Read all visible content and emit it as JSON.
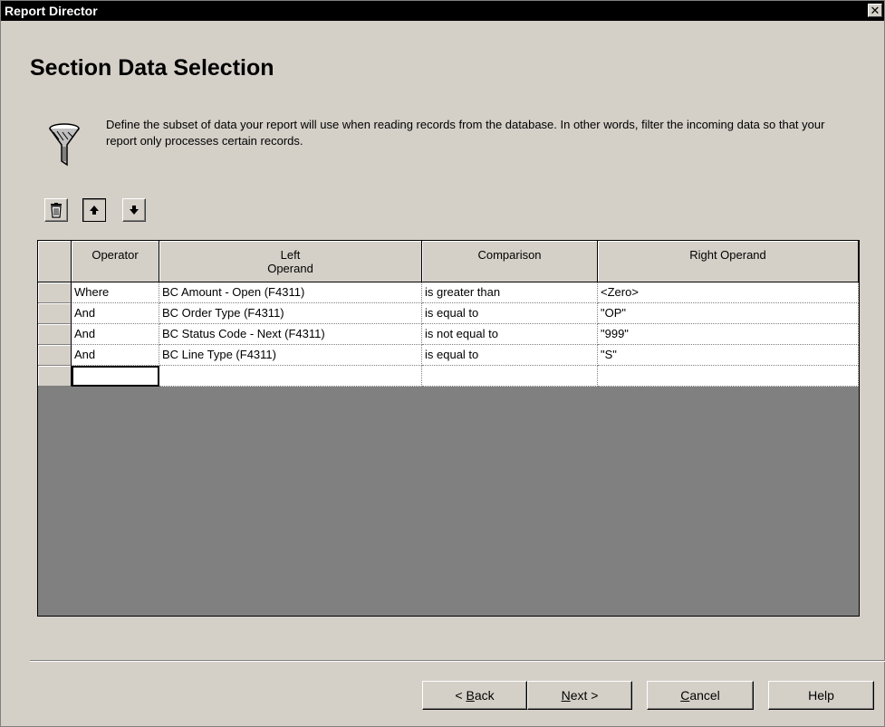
{
  "window": {
    "title": "Report Director",
    "close_glyph": "✕"
  },
  "page": {
    "heading": "Section Data Selection",
    "description": "Define the subset of data your report will use when reading records from the database.  In other words, filter the incoming data so that your report only processes certain records."
  },
  "toolbar": {
    "delete_icon": "trash-icon",
    "move_up_icon": "arrow-up-icon",
    "move_down_icon": "arrow-down-icon"
  },
  "grid": {
    "columns": [
      "Operator",
      "Left\nOperand",
      "Comparison",
      "Right Operand"
    ],
    "rows": [
      {
        "operator": "Where",
        "left": "BC Amount - Open (F4311)",
        "comparison": "is greater than",
        "right": "<Zero>"
      },
      {
        "operator": "And",
        "left": "BC Order Type (F4311)",
        "comparison": "is equal to",
        "right": "\"OP\""
      },
      {
        "operator": "And",
        "left": "BC Status Code - Next (F4311)",
        "comparison": "is not equal to",
        "right": "\"999\""
      },
      {
        "operator": "And",
        "left": "BC Line Type (F4311)",
        "comparison": "is equal to",
        "right": "\"S\""
      },
      {
        "operator": "",
        "left": "",
        "comparison": "",
        "right": ""
      }
    ]
  },
  "buttons": {
    "back_prefix": "< ",
    "back_ul": "B",
    "back_rest": "ack",
    "next_ul": "N",
    "next_rest": "ext >",
    "cancel_ul": "C",
    "cancel_rest": "ancel",
    "help": "Help"
  },
  "colors": {
    "window_bg": "#d4d0c8",
    "titlebar": "#000000",
    "grid_empty": "#808080"
  }
}
